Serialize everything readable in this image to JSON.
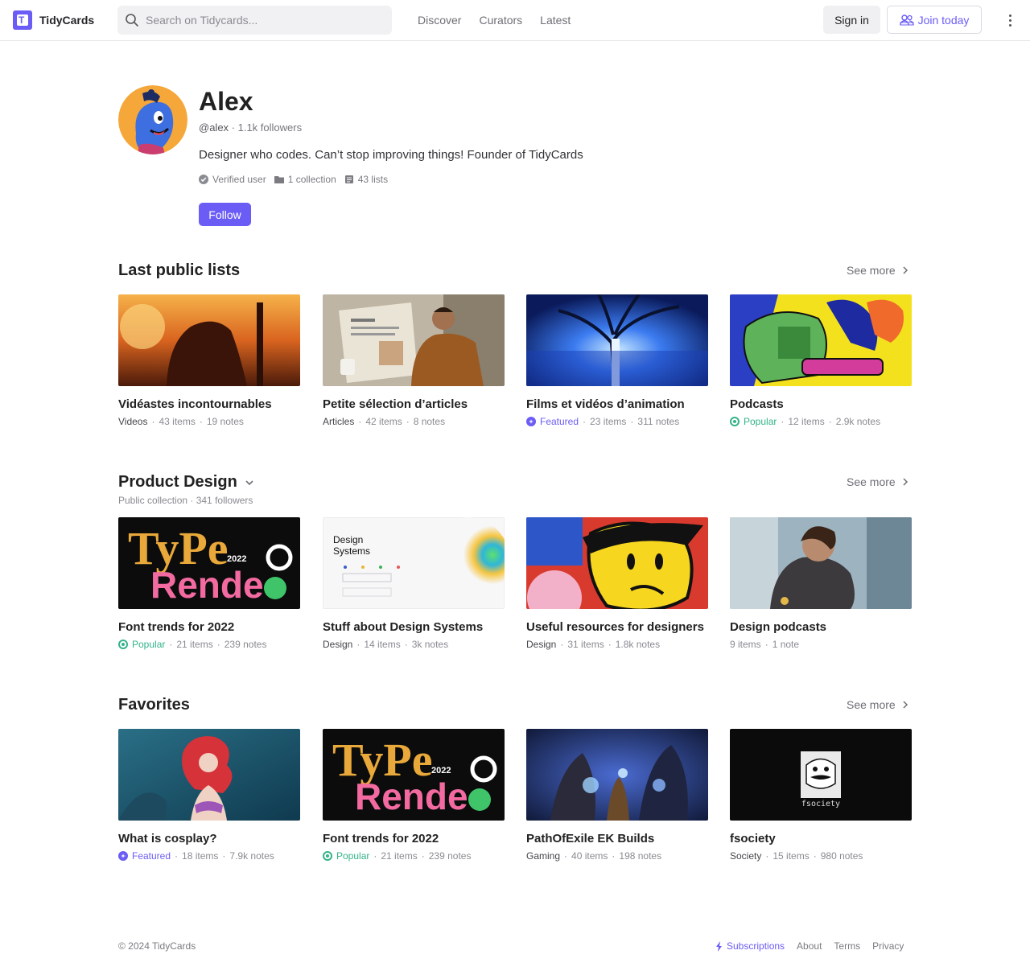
{
  "brand": {
    "name": "TidyCards"
  },
  "search": {
    "placeholder": "Search on Tidycards..."
  },
  "nav": [
    {
      "label": "Discover"
    },
    {
      "label": "Curators"
    },
    {
      "label": "Latest"
    }
  ],
  "auth": {
    "signin": "Sign in",
    "join": "Join today"
  },
  "profile": {
    "name": "Alex",
    "handle": "@alex",
    "followers": "1.1k followers",
    "bio": "Designer who codes. Can’t stop improving things! Founder of TidyCards",
    "verified": "Verified user",
    "collections": "1 collection",
    "lists": "43 lists",
    "follow": "Follow"
  },
  "see_more": "See more",
  "sections": [
    {
      "title": "Last public lists",
      "cards": [
        {
          "title": "Vidéastes incontournables",
          "category": "Videos",
          "items": "43 items",
          "notes": "19 notes",
          "image": "sunset-camera-person"
        },
        {
          "title": "Petite sélection d’articles",
          "category": "Articles",
          "items": "42 items",
          "notes": "8 notes",
          "image": "man-reading-newspaper"
        },
        {
          "title": "Films et vidéos d’animation",
          "badge": "Featured",
          "items": "23 items",
          "notes": "311 notes",
          "image": "glowing-tree-animation"
        },
        {
          "title": "Podcasts",
          "badge": "Popular",
          "items": "12 items",
          "notes": "2.9k notes",
          "image": "phone-illustration"
        }
      ]
    },
    {
      "title": "Product Design",
      "subtitle": "Public collection · 341 followers",
      "cards": [
        {
          "title": "Font trends for 2022",
          "badge": "Popular",
          "items": "21 items",
          "notes": "239 notes",
          "image": "type-trends-2022"
        },
        {
          "title": "Stuff about Design Systems",
          "category": "Design",
          "items": "14 items",
          "notes": "3k notes",
          "image": "design-systems-gradient"
        },
        {
          "title": "Useful resources for designers",
          "category": "Design",
          "items": "31 items",
          "notes": "1.8k notes",
          "image": "cartoon-characters"
        },
        {
          "title": "Design podcasts",
          "items": "9 items",
          "notes": "1 note",
          "image": "woman-with-headphones"
        }
      ]
    },
    {
      "title": "Favorites",
      "cards": [
        {
          "title": "What is cosplay?",
          "badge": "Featured",
          "items": "18 items",
          "notes": "7.9k notes",
          "image": "cosplay-mermaid"
        },
        {
          "title": "Font trends for 2022",
          "badge": "Popular",
          "items": "21 items",
          "notes": "239 notes",
          "image": "type-trends-2022"
        },
        {
          "title": "PathOfExile EK Builds",
          "category": "Gaming",
          "items": "40 items",
          "notes": "198 notes",
          "image": "game-art"
        },
        {
          "title": "fsociety",
          "category": "Society",
          "items": "15 items",
          "notes": "980 notes",
          "image": "fsociety-mask"
        }
      ]
    }
  ],
  "thumb_text": {
    "type_line1": "TyPe",
    "type_line2": "Rende",
    "type_year": "2022",
    "ds_title": "Design",
    "ds_title2": "Systems",
    "fsociety": "fsociety"
  },
  "footer": {
    "copyright": "© 2024 TidyCards",
    "links": [
      {
        "label": "Subscriptions"
      },
      {
        "label": "About"
      },
      {
        "label": "Terms"
      },
      {
        "label": "Privacy"
      }
    ]
  },
  "colors": {
    "accent": "#6b5cf6",
    "popular": "#34b38a"
  }
}
